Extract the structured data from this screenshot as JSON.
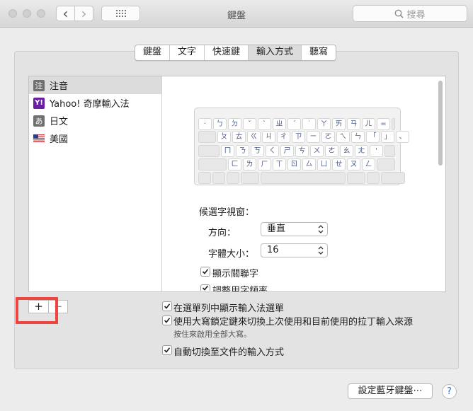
{
  "window": {
    "title": "鍵盤",
    "search_placeholder": "搜尋"
  },
  "toolbar": {
    "back_glyph": "‹",
    "forward_glyph": "›"
  },
  "tabs": [
    {
      "label": "鍵盤"
    },
    {
      "label": "文字"
    },
    {
      "label": "快速鍵"
    },
    {
      "label": "輸入方式",
      "active": true
    },
    {
      "label": "聽寫"
    }
  ],
  "sources": [
    {
      "badge": "注",
      "label": "注音",
      "selected": true
    },
    {
      "badge": "Y!",
      "label": "Yahoo! 奇摩輸入法"
    },
    {
      "badge": "あ",
      "label": "日文"
    },
    {
      "badge": "flag",
      "label": "美國"
    }
  ],
  "keyboard": {
    "row1": [
      "·",
      "ㄅ",
      "ㄉ",
      "ˇ",
      "ˋ",
      "ㄓ",
      "ˊ",
      "˙",
      "ㄚ",
      "ㄞ",
      "ㄢ",
      "ㄦ",
      "="
    ],
    "row2": [
      "ㄆ",
      "ㄊ",
      "ㄍ",
      "ㄐ",
      "ㄔ",
      "ㄗ",
      "ㄧ",
      "ㄛ",
      "ㄟ",
      "ㄣ",
      "「",
      "」",
      "、"
    ],
    "row3": [
      "ㄇ",
      "ㄋ",
      "ㄎ",
      "ㄑ",
      "ㄕ",
      "ㄘ",
      "ㄨ",
      "ㄜ",
      "ㄠ",
      "ㄤ",
      "'"
    ],
    "row4": [
      "ㄈ",
      "ㄌ",
      "ㄏ",
      "ㄒ",
      "ㄖ",
      "ㄙ",
      "ㄩ",
      "ㄝ",
      "ㄡ",
      "ㄥ"
    ]
  },
  "candidate_window": {
    "heading": "候選字視窗：",
    "direction_label": "方向：",
    "direction_value": "垂直",
    "font_size_label": "字體大小：",
    "font_size_value": "16",
    "show_related_label": "顯示關聯字",
    "adjust_freq_label": "調整用字頻率"
  },
  "list_buttons": {
    "add": "+",
    "remove": "−"
  },
  "options": {
    "show_menu": "在選單列中顯示輸入法選單",
    "caps_lock": "使用大寫鎖定鍵來切換上次使用和目前使用的拉丁輸入來源",
    "caps_note": "按住來啟用全部大寫。",
    "auto_switch": "自動切換至文件的輸入方式"
  },
  "footer": {
    "bluetooth_button": "設定藍牙鍵盤⋯",
    "help": "?"
  },
  "colors": {
    "highlight": "#f0453f",
    "badge_zhuyin": "#707070",
    "badge_yahoo": "#6b1fa3",
    "keycap_text": "#4a5a8a"
  }
}
